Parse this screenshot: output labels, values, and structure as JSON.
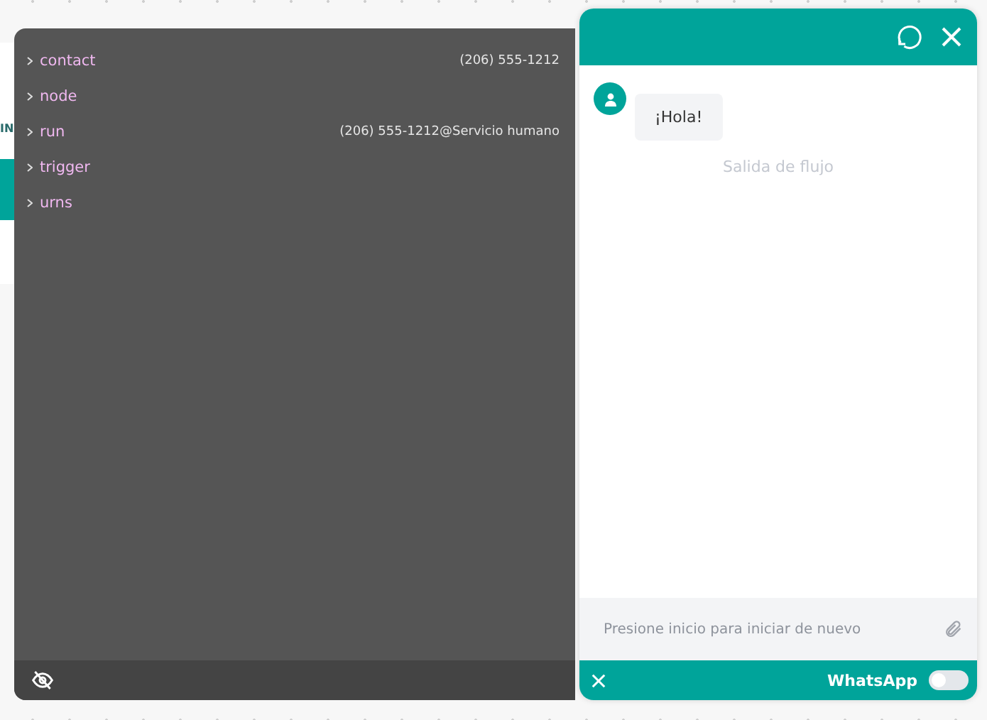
{
  "background": {
    "label": "IN"
  },
  "debug_panel": {
    "items": [
      {
        "key": "contact",
        "value": "(206) 555-1212",
        "expanded": false
      },
      {
        "key": "node",
        "expanded": false
      },
      {
        "key": "run",
        "value": "(206) 555-1212@Servicio humano",
        "expanded": false
      },
      {
        "key": "trigger",
        "expanded": false
      },
      {
        "key": "urns",
        "expanded": false
      }
    ]
  },
  "chat": {
    "messages": [
      {
        "kind": "bot",
        "text": "¡Hola!"
      },
      {
        "kind": "status",
        "text": "Salida de flujo"
      }
    ],
    "input": {
      "placeholder": "Presione inicio para iniciar de nuevo"
    },
    "footer": {
      "channel": "WhatsApp",
      "on": false
    }
  }
}
